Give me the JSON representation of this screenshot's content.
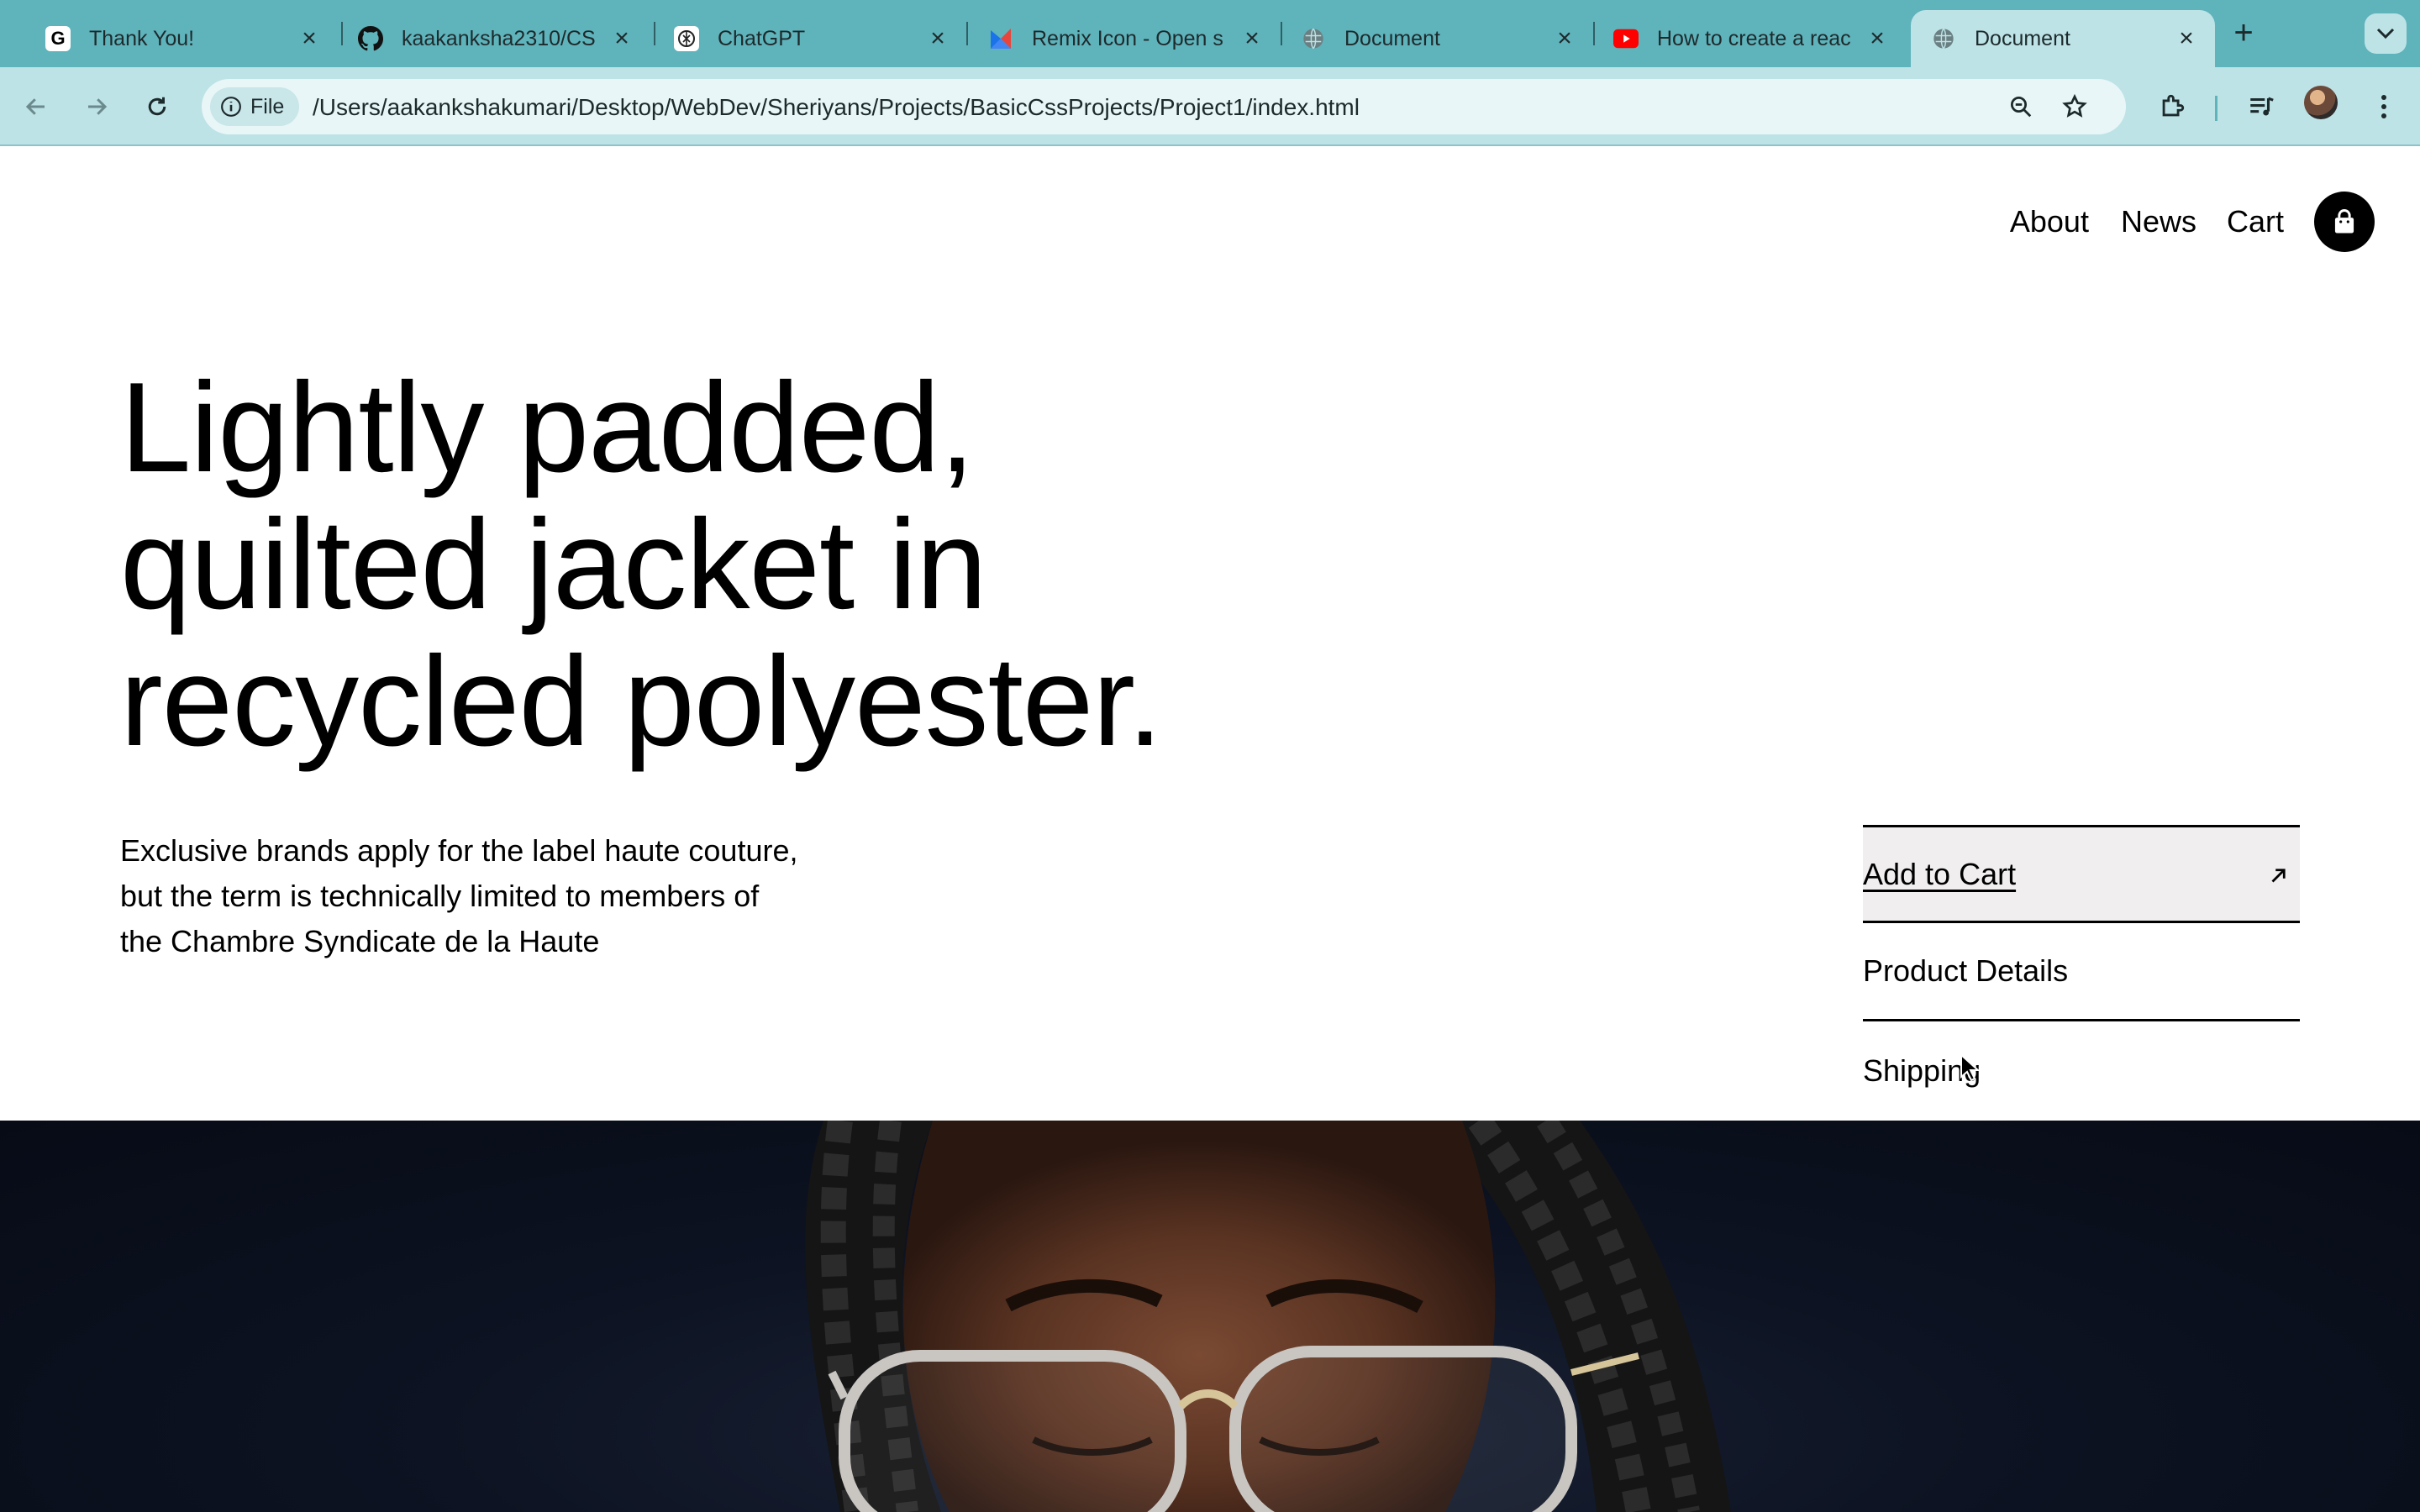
{
  "browser": {
    "tabs": [
      {
        "title": "Thank You!",
        "favicon": "grammarly-icon"
      },
      {
        "title": "kaakanksha2310/CS",
        "favicon": "github-icon"
      },
      {
        "title": "ChatGPT",
        "favicon": "chatgpt-icon"
      },
      {
        "title": "Remix Icon - Open s",
        "favicon": "remix-icon"
      },
      {
        "title": "Document",
        "favicon": "globe-icon"
      },
      {
        "title": "How to create a reac",
        "favicon": "youtube-icon"
      },
      {
        "title": "Document",
        "favicon": "globe-icon",
        "active": true
      }
    ],
    "file_chip": "File",
    "url": "/Users/aakankshakumari/Desktop/WebDev/Sheriyans/Projects/BasicCssProjects/Project1/index.html",
    "accent_color": "#5fb3bb",
    "toolbar_color": "#bde3e6"
  },
  "site": {
    "nav": [
      "About",
      "News",
      "Cart"
    ],
    "headline": [
      "Lightly padded,",
      "quilted jacket in",
      "recycled polyester."
    ],
    "description": "Exclusive brands apply for the label haute couture, but the term is technically limited to members of the Chambre Syndicate de la Haute",
    "accordion": [
      {
        "label": "Add to Cart",
        "icon": "arrow-up-right-icon"
      },
      {
        "label": "Product Details"
      },
      {
        "label": "Shipping"
      }
    ]
  }
}
